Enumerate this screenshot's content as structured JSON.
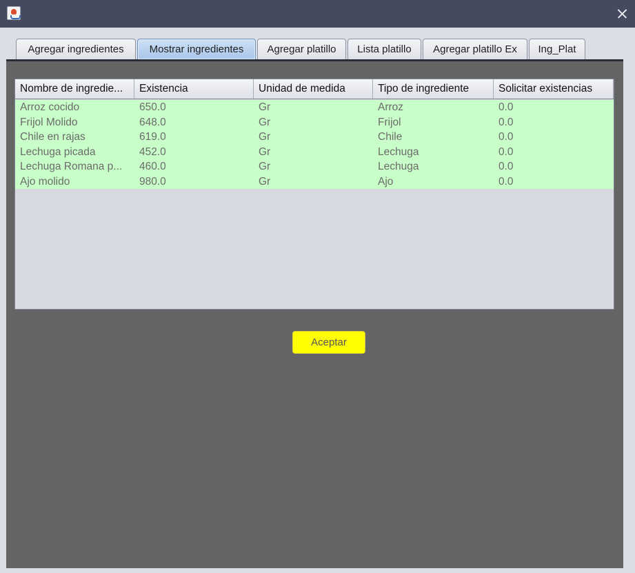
{
  "window": {
    "icon": "java-app-icon",
    "close_icon": "close-icon"
  },
  "tabs": [
    {
      "label": "Agregar ingredientes",
      "active": false
    },
    {
      "label": "Mostrar ingredientes",
      "active": true
    },
    {
      "label": "Agregar platillo",
      "active": false
    },
    {
      "label": "Lista platillo",
      "active": false
    },
    {
      "label": "Agregar platillo Ex",
      "active": false
    },
    {
      "label": "Ing_Plat",
      "active": false
    }
  ],
  "table": {
    "columns": [
      "Nombre de ingredie...",
      "Existencia",
      "Unidad de medida",
      "Tipo de ingrediente",
      "Solicitar existencias"
    ],
    "rows": [
      [
        "Arroz cocido",
        "650.0",
        "Gr",
        "Arroz",
        "0.0"
      ],
      [
        "Frijol Molido",
        "648.0",
        "Gr",
        "Frijol",
        "0.0"
      ],
      [
        "Chile en rajas",
        "619.0",
        "Gr",
        "Chile",
        "0.0"
      ],
      [
        "Lechuga picada",
        "452.0",
        "Gr",
        "Lechuga",
        "0.0"
      ],
      [
        "Lechuga Romana p...",
        "460.0",
        "Gr",
        "Lechuga",
        "0.0"
      ],
      [
        "Ajo molido",
        "980.0",
        "Gr",
        "Ajo",
        "0.0"
      ]
    ],
    "row_color": "#c8ffc8"
  },
  "buttons": {
    "accept_label": "Aceptar",
    "accept_color": "#ffff00"
  },
  "colors": {
    "titlebar": "#464a5e",
    "panel": "#646464",
    "active_tab": "#a8c6ea"
  }
}
